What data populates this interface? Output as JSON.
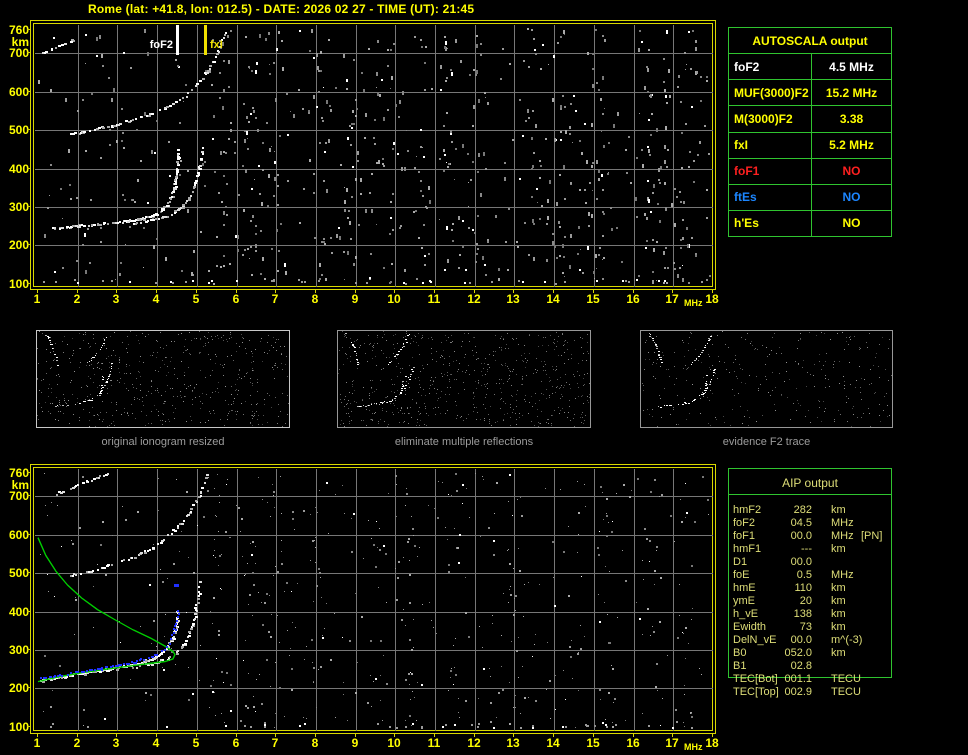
{
  "title": "Rome (lat: +41.8, lon: 012.5) - DATE: 2026 02 27 - TIME (UT): 21:45",
  "axis": {
    "x_ticks": [
      "1",
      "2",
      "3",
      "4",
      "5",
      "6",
      "7",
      "8",
      "9",
      "10",
      "11",
      "12",
      "13",
      "14",
      "15",
      "16",
      "17",
      "18"
    ],
    "x_unit": "MHz",
    "y_ticks": [
      760,
      700,
      600,
      500,
      400,
      300,
      200,
      100
    ],
    "y_unit": "km",
    "x_range": [
      1,
      18
    ],
    "y_range": [
      100,
      760
    ]
  },
  "colors": {
    "background": "#000000",
    "accent_yellow": "#ffff00",
    "plot_border": "#d9d900",
    "grid": "#777777",
    "table_border": "#2fc42f",
    "aip_text": "#dede78",
    "caption_gray": "#9c9c9c",
    "profile_green": "#00cc00",
    "trace_blue": "#2030ff",
    "status_red": "#ff2020",
    "status_blue": "#1c86ff"
  },
  "top_plot": {
    "markers": [
      {
        "label": "foF2",
        "freq": 4.5,
        "color": "#ffffff"
      },
      {
        "label": "fxI",
        "freq": 5.2,
        "color": "#f0e000"
      }
    ],
    "traces": {
      "main_o": [
        [
          1.35,
          246
        ],
        [
          1.7,
          250
        ],
        [
          2.1,
          254
        ],
        [
          2.5,
          257
        ],
        [
          2.9,
          261
        ],
        [
          3.2,
          265
        ],
        [
          3.5,
          270
        ],
        [
          3.75,
          276
        ],
        [
          3.95,
          284
        ],
        [
          4.1,
          294
        ],
        [
          4.22,
          307
        ],
        [
          4.32,
          324
        ],
        [
          4.4,
          346
        ],
        [
          4.45,
          372
        ],
        [
          4.48,
          400
        ],
        [
          4.5,
          428
        ],
        [
          4.51,
          452
        ]
      ],
      "main_x": [
        [
          3.35,
          259
        ],
        [
          3.7,
          264
        ],
        [
          4.0,
          270
        ],
        [
          4.25,
          279
        ],
        [
          4.45,
          290
        ],
        [
          4.62,
          303
        ],
        [
          4.77,
          320
        ],
        [
          4.88,
          342
        ],
        [
          4.97,
          370
        ],
        [
          5.04,
          400
        ],
        [
          5.09,
          428
        ],
        [
          5.13,
          455
        ]
      ],
      "hop2": [
        [
          1.75,
          490
        ],
        [
          2.1,
          498
        ],
        [
          2.5,
          506
        ],
        [
          2.9,
          515
        ],
        [
          3.3,
          526
        ],
        [
          3.7,
          539
        ],
        [
          4.1,
          555
        ],
        [
          4.45,
          573
        ],
        [
          4.75,
          595
        ],
        [
          5.0,
          620
        ],
        [
          5.2,
          648
        ],
        [
          5.38,
          678
        ],
        [
          5.52,
          706
        ],
        [
          5.62,
          732
        ],
        [
          5.7,
          755
        ]
      ],
      "corner": [
        [
          1.1,
          702
        ],
        [
          1.35,
          714
        ],
        [
          1.6,
          725
        ],
        [
          1.85,
          736
        ],
        [
          2.1,
          746
        ],
        [
          2.35,
          754
        ]
      ]
    },
    "noise_clusters": [
      5.6,
      6.3,
      6.95,
      8.2,
      8.8,
      9.4,
      10.0,
      10.6,
      11.3,
      12.1,
      13.4,
      14.2,
      15.1,
      16.3,
      16.9,
      17.4
    ],
    "noise": {
      "uniform": 430,
      "cluster": 340,
      "bottom_row": 45
    }
  },
  "bottom_plot": {
    "traces": {
      "main_o": [
        [
          1.05,
          222
        ],
        [
          1.4,
          228
        ],
        [
          1.8,
          235
        ],
        [
          2.2,
          242
        ],
        [
          2.6,
          249
        ],
        [
          3.0,
          256
        ],
        [
          3.35,
          263
        ],
        [
          3.65,
          271
        ],
        [
          3.9,
          281
        ],
        [
          4.1,
          293
        ],
        [
          4.25,
          308
        ],
        [
          4.35,
          327
        ],
        [
          4.43,
          350
        ],
        [
          4.48,
          376
        ],
        [
          4.51,
          400
        ]
      ],
      "main_x": [
        [
          3.4,
          258
        ],
        [
          3.75,
          264
        ],
        [
          4.05,
          272
        ],
        [
          4.3,
          283
        ],
        [
          4.5,
          298
        ],
        [
          4.65,
          316
        ],
        [
          4.78,
          340
        ],
        [
          4.88,
          370
        ],
        [
          4.96,
          405
        ],
        [
          5.02,
          442
        ],
        [
          5.06,
          478
        ]
      ],
      "hop2": [
        [
          1.8,
          495
        ],
        [
          2.2,
          505
        ],
        [
          2.6,
          516
        ],
        [
          3.0,
          528
        ],
        [
          3.4,
          545
        ],
        [
          3.85,
          565
        ],
        [
          4.1,
          585
        ],
        [
          4.35,
          607
        ],
        [
          4.6,
          632
        ],
        [
          4.8,
          658
        ],
        [
          4.95,
          685
        ],
        [
          5.08,
          712
        ],
        [
          5.18,
          738
        ],
        [
          5.25,
          757
        ]
      ],
      "corner": [
        [
          1.3,
          700
        ],
        [
          1.6,
          714
        ],
        [
          1.9,
          727
        ],
        [
          2.2,
          739
        ],
        [
          2.5,
          750
        ],
        [
          2.75,
          758
        ]
      ]
    },
    "profile_green": [
      [
        1.0,
        592
      ],
      [
        1.2,
        545
      ],
      [
        1.45,
        505
      ],
      [
        1.75,
        468
      ],
      [
        2.1,
        435
      ],
      [
        2.5,
        405
      ],
      [
        2.95,
        378
      ],
      [
        3.4,
        352
      ],
      [
        3.85,
        330
      ],
      [
        4.2,
        310
      ],
      [
        4.4,
        296
      ],
      [
        4.45,
        288
      ],
      [
        4.4,
        277
      ],
      [
        4.2,
        270
      ],
      [
        3.8,
        265
      ],
      [
        3.3,
        258
      ],
      [
        2.7,
        250
      ],
      [
        2.1,
        241
      ],
      [
        1.5,
        230
      ],
      [
        1.0,
        218
      ]
    ],
    "blue_offset_km": 6,
    "blue_dot": [
      4.48,
      472
    ],
    "noise_clusters": [
      5.5,
      6.3,
      7.0,
      8.0,
      9.5,
      10.3,
      11.5,
      12.4,
      13.0,
      14.5,
      15.3,
      16.5,
      17.2
    ],
    "noise": {
      "uniform": 340,
      "cluster": 240,
      "bottom_row": 40
    }
  },
  "panels": [
    {
      "caption": "original ionogram resized",
      "noise": 540,
      "bright": 1.0
    },
    {
      "caption": "eliminate multiple reflections",
      "noise": 640,
      "bright": 0.85
    },
    {
      "caption": "evidence F2 trace",
      "noise": 300,
      "bright": 1.0
    }
  ],
  "mini_traces": {
    "hop1": [
      [
        0.07,
        0.78
      ],
      [
        0.12,
        0.77
      ],
      [
        0.17,
        0.75
      ],
      [
        0.21,
        0.72
      ],
      [
        0.25,
        0.64
      ],
      [
        0.27,
        0.55
      ],
      [
        0.285,
        0.45
      ],
      [
        0.295,
        0.34
      ]
    ],
    "hopx": [
      [
        0.245,
        0.66
      ],
      [
        0.255,
        0.56
      ],
      [
        0.262,
        0.47
      ]
    ],
    "hop2": [
      [
        0.2,
        0.34
      ],
      [
        0.23,
        0.25
      ],
      [
        0.255,
        0.16
      ],
      [
        0.27,
        0.08
      ],
      [
        0.28,
        0.03
      ]
    ],
    "arc": [
      [
        0.03,
        0.02
      ],
      [
        0.045,
        0.08
      ],
      [
        0.058,
        0.15
      ],
      [
        0.07,
        0.24
      ],
      [
        0.078,
        0.34
      ]
    ]
  },
  "autoscala": {
    "header": "AUTOSCALA output",
    "rows": [
      {
        "label": "foF2",
        "value": "4.5 MHz",
        "color": "#ffffff"
      },
      {
        "label": "MUF(3000)F2",
        "value": "15.2 MHz",
        "color": "#ffff00"
      },
      {
        "label": "M(3000)F2",
        "value": "3.38",
        "color": "#ffff00"
      },
      {
        "label": "fxI",
        "value": "5.2 MHz",
        "color": "#ffff00"
      },
      {
        "label": "foF1",
        "value": "NO",
        "color": "#ff2020"
      },
      {
        "label": "ftEs",
        "value": "NO",
        "color": "#1c86ff"
      },
      {
        "label": "h'Es",
        "value": "NO",
        "color": "#ffff00"
      }
    ]
  },
  "aip": {
    "header": "AIP output",
    "rows": [
      {
        "label": "hmF2",
        "value": "282",
        "unit": "km",
        "extra": ""
      },
      {
        "label": "foF2",
        "value": "04.5",
        "unit": "MHz",
        "extra": ""
      },
      {
        "label": "foF1",
        "value": "00.0",
        "unit": "MHz",
        "extra": "[PN]"
      },
      {
        "label": "hmF1",
        "value": "---",
        "unit": "km",
        "extra": ""
      },
      {
        "label": "D1",
        "value": "00.0",
        "unit": "",
        "extra": ""
      },
      {
        "label": "foE",
        "value": "0.5",
        "unit": "MHz",
        "extra": ""
      },
      {
        "label": "hmE",
        "value": "110",
        "unit": "km",
        "extra": ""
      },
      {
        "label": "ymE",
        "value": "20",
        "unit": "km",
        "extra": ""
      },
      {
        "label": "h_vE",
        "value": "138",
        "unit": "km",
        "extra": ""
      },
      {
        "label": "Ewidth",
        "value": "73",
        "unit": "km",
        "extra": ""
      },
      {
        "label": "DelN_vE",
        "value": "00.0",
        "unit": "m^(-3)",
        "extra": ""
      },
      {
        "label": "B0",
        "value": "052.0",
        "unit": "km",
        "extra": ""
      },
      {
        "label": "B1",
        "value": "02.8",
        "unit": "",
        "extra": ""
      },
      {
        "label": "TEC[Bot]",
        "value": "001.1",
        "unit": "TECU",
        "extra": ""
      },
      {
        "label": "TEC[Top]",
        "value": "002.9",
        "unit": "TECU",
        "extra": ""
      }
    ]
  }
}
